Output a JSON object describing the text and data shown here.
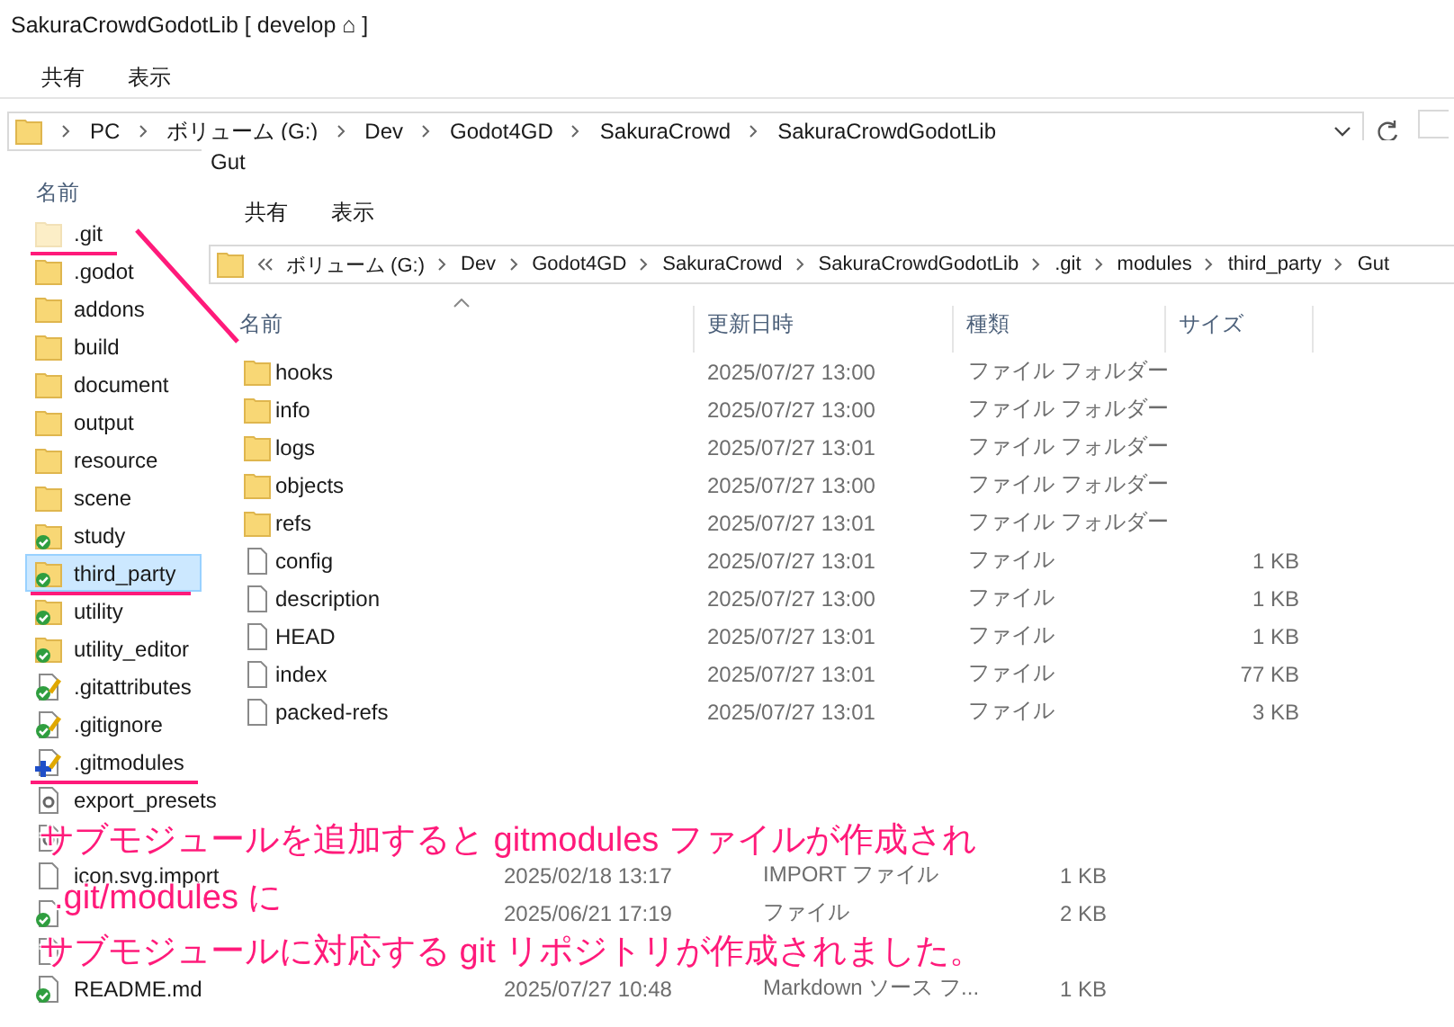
{
  "window": {
    "title": "SakuraCrowdGodotLib [ develop ⌂ ]"
  },
  "ribbon_tabs": [
    {
      "label": "共有"
    },
    {
      "label": "表示"
    }
  ],
  "address_bar": {
    "crumbs": [
      "PC",
      "ボリューム (G:)",
      "Dev",
      "Godot4GD",
      "SakuraCrowd",
      "SakuraCrowdGodotLib"
    ]
  },
  "file_list": {
    "columns": [
      "名前"
    ],
    "rows": [
      {
        "name": ".git",
        "kind": "folder",
        "hidden": true,
        "selected": false,
        "underlined": true
      },
      {
        "name": ".godot",
        "kind": "folder",
        "hidden": false,
        "selected": false,
        "underlined": false
      },
      {
        "name": "addons",
        "kind": "folder",
        "hidden": false,
        "selected": false,
        "underlined": false
      },
      {
        "name": "build",
        "kind": "folder",
        "hidden": false,
        "selected": false,
        "underlined": false
      },
      {
        "name": "document",
        "kind": "folder",
        "hidden": false,
        "selected": false,
        "underlined": false
      },
      {
        "name": "output",
        "kind": "folder",
        "hidden": false,
        "selected": false,
        "underlined": false
      },
      {
        "name": "resource",
        "kind": "folder",
        "hidden": false,
        "selected": false,
        "underlined": false
      },
      {
        "name": "scene",
        "kind": "folder",
        "hidden": false,
        "selected": false,
        "underlined": false
      },
      {
        "name": "study",
        "kind": "folder-synced",
        "hidden": false,
        "selected": false,
        "underlined": false
      },
      {
        "name": "third_party",
        "kind": "folder-synced",
        "hidden": false,
        "selected": true,
        "underlined": true
      },
      {
        "name": "utility",
        "kind": "folder-synced",
        "hidden": false,
        "selected": false,
        "underlined": false
      },
      {
        "name": "utility_editor",
        "kind": "folder-synced",
        "hidden": false,
        "selected": false,
        "underlined": false
      },
      {
        "name": ".gitattributes",
        "kind": "file-modified",
        "hidden": false,
        "selected": false,
        "underlined": false
      },
      {
        "name": ".gitignore",
        "kind": "file-modified",
        "hidden": false,
        "selected": false,
        "underlined": false
      },
      {
        "name": ".gitmodules",
        "kind": "file-added",
        "hidden": false,
        "selected": false,
        "underlined": true
      },
      {
        "name": "export_presets",
        "kind": "settings",
        "hidden": false,
        "selected": false,
        "underlined": false
      },
      {
        "kind": "settings",
        "hidden": false,
        "selected": false,
        "underlined": false
      },
      {
        "name": "icon.svg.import",
        "kind": "file",
        "hidden": false,
        "selected": false,
        "underlined": false,
        "date": "2025/02/18 13:17",
        "type": "IMPORT ファイル",
        "size": "1 KB"
      },
      {
        "kind": "file-synced",
        "hidden": false,
        "selected": false,
        "underlined": false,
        "date": "2025/06/21 17:19",
        "type": "ファイル",
        "size": "2 KB"
      },
      {
        "kind": "file",
        "hidden": false,
        "selected": false,
        "underlined": false
      },
      {
        "name": "README.md",
        "kind": "file-synced",
        "hidden": false,
        "selected": false,
        "underlined": false,
        "date": "2025/07/27 10:48",
        "type": "Markdown ソース フ...",
        "size": "1 KB"
      }
    ]
  },
  "inner_window": {
    "title": "Gut",
    "ribbon_tabs": [
      {
        "label": "共有"
      },
      {
        "label": "表示"
      }
    ],
    "address_bar": {
      "crumbs": [
        "ボリューム (G:)",
        "Dev",
        "Godot4GD",
        "SakuraCrowd",
        "SakuraCrowdGodotLib",
        ".git",
        "modules",
        "third_party",
        "Gut"
      ]
    },
    "columns": [
      "名前",
      "更新日時",
      "種類",
      "サイズ"
    ],
    "rows": [
      {
        "name": "hooks",
        "kind": "folder",
        "date": "2025/07/27 13:00",
        "type": "ファイル フォルダー"
      },
      {
        "name": "info",
        "kind": "folder",
        "date": "2025/07/27 13:00",
        "type": "ファイル フォルダー"
      },
      {
        "name": "logs",
        "kind": "folder",
        "date": "2025/07/27 13:01",
        "type": "ファイル フォルダー"
      },
      {
        "name": "objects",
        "kind": "folder",
        "date": "2025/07/27 13:00",
        "type": "ファイル フォルダー"
      },
      {
        "name": "refs",
        "kind": "folder",
        "date": "2025/07/27 13:01",
        "type": "ファイル フォルダー"
      },
      {
        "name": "config",
        "kind": "file",
        "date": "2025/07/27 13:01",
        "type": "ファイル",
        "size": "1 KB"
      },
      {
        "name": "description",
        "kind": "file",
        "date": "2025/07/27 13:00",
        "type": "ファイル",
        "size": "1 KB"
      },
      {
        "name": "HEAD",
        "kind": "file",
        "date": "2025/07/27 13:01",
        "type": "ファイル",
        "size": "1 KB"
      },
      {
        "name": "index",
        "kind": "file",
        "date": "2025/07/27 13:01",
        "type": "ファイル",
        "size": "77 KB"
      },
      {
        "name": "packed-refs",
        "kind": "file",
        "date": "2025/07/27 13:01",
        "type": "ファイル",
        "size": "3 KB"
      }
    ]
  },
  "caption": {
    "lines": [
      "サブモジュールを追加すると gitmodules ファイルが作成され",
      ".git/modules に",
      "サブモジュールに対応する git リポジトリが作成されました。"
    ]
  }
}
